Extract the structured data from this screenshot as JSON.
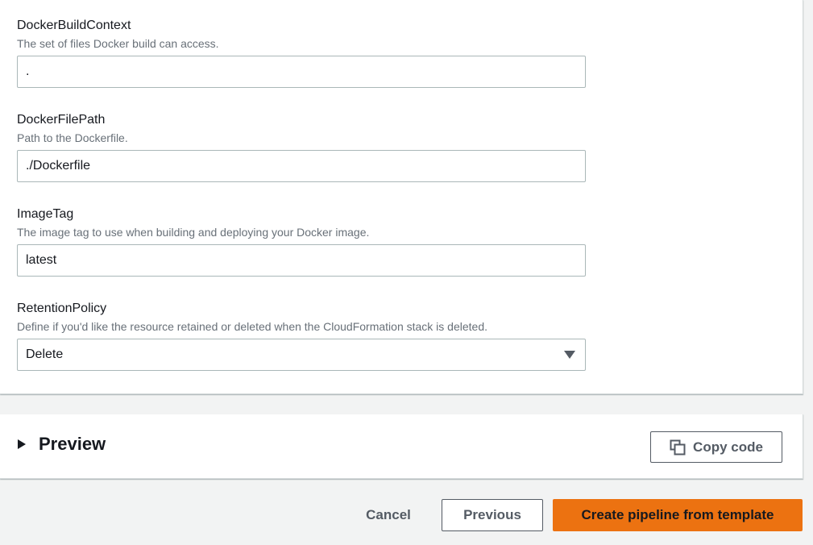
{
  "fields": [
    {
      "label": "DockerBuildContext",
      "description": "The set of files Docker build can access.",
      "value": "."
    },
    {
      "label": "DockerFilePath",
      "description": "Path to the Dockerfile.",
      "value": "./Dockerfile"
    },
    {
      "label": "ImageTag",
      "description": "The image tag to use when building and deploying your Docker image.",
      "value": "latest"
    }
  ],
  "retention": {
    "label": "RetentionPolicy",
    "description": "Define if you'd like the resource retained or deleted when the CloudFormation stack is deleted.",
    "selected": "Delete"
  },
  "preview": {
    "title": "Preview",
    "copy_label": "Copy code"
  },
  "footer": {
    "cancel_label": "Cancel",
    "previous_label": "Previous",
    "create_label": "Create pipeline from template"
  },
  "colors": {
    "primary_button": "#ec7211",
    "page_background": "#f2f3f3",
    "secondary_text": "#687078"
  }
}
